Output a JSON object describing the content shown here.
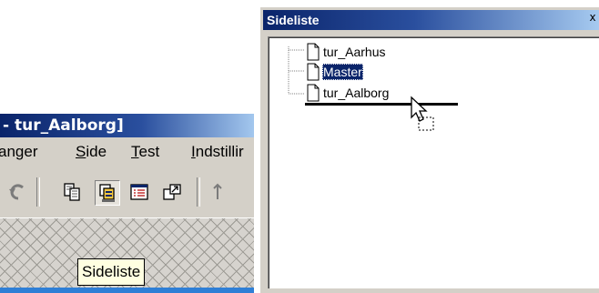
{
  "app_window": {
    "title": "- tur_Aalborg]",
    "menu": [
      "anger",
      "Side",
      "Test",
      "Indstillir"
    ],
    "tooltip": "Sideliste"
  },
  "panel": {
    "title": "Sideliste",
    "close_label": "x",
    "pages": [
      {
        "label": "tur_Aarhus",
        "selected": false
      },
      {
        "label": "Master",
        "selected": true
      },
      {
        "label": "tur_Aalborg",
        "selected": false
      }
    ]
  },
  "colors": {
    "titlebar_start": "#0a246a",
    "selection": "#0a246a",
    "tooltip_bg": "#ffffe1",
    "face": "#d4d0c8"
  },
  "icons": [
    "undo-icon",
    "copy-pages-icon",
    "page-list-icon",
    "properties-icon",
    "popout-icon",
    "drag-move-cursor-icon",
    "document-icon"
  ]
}
